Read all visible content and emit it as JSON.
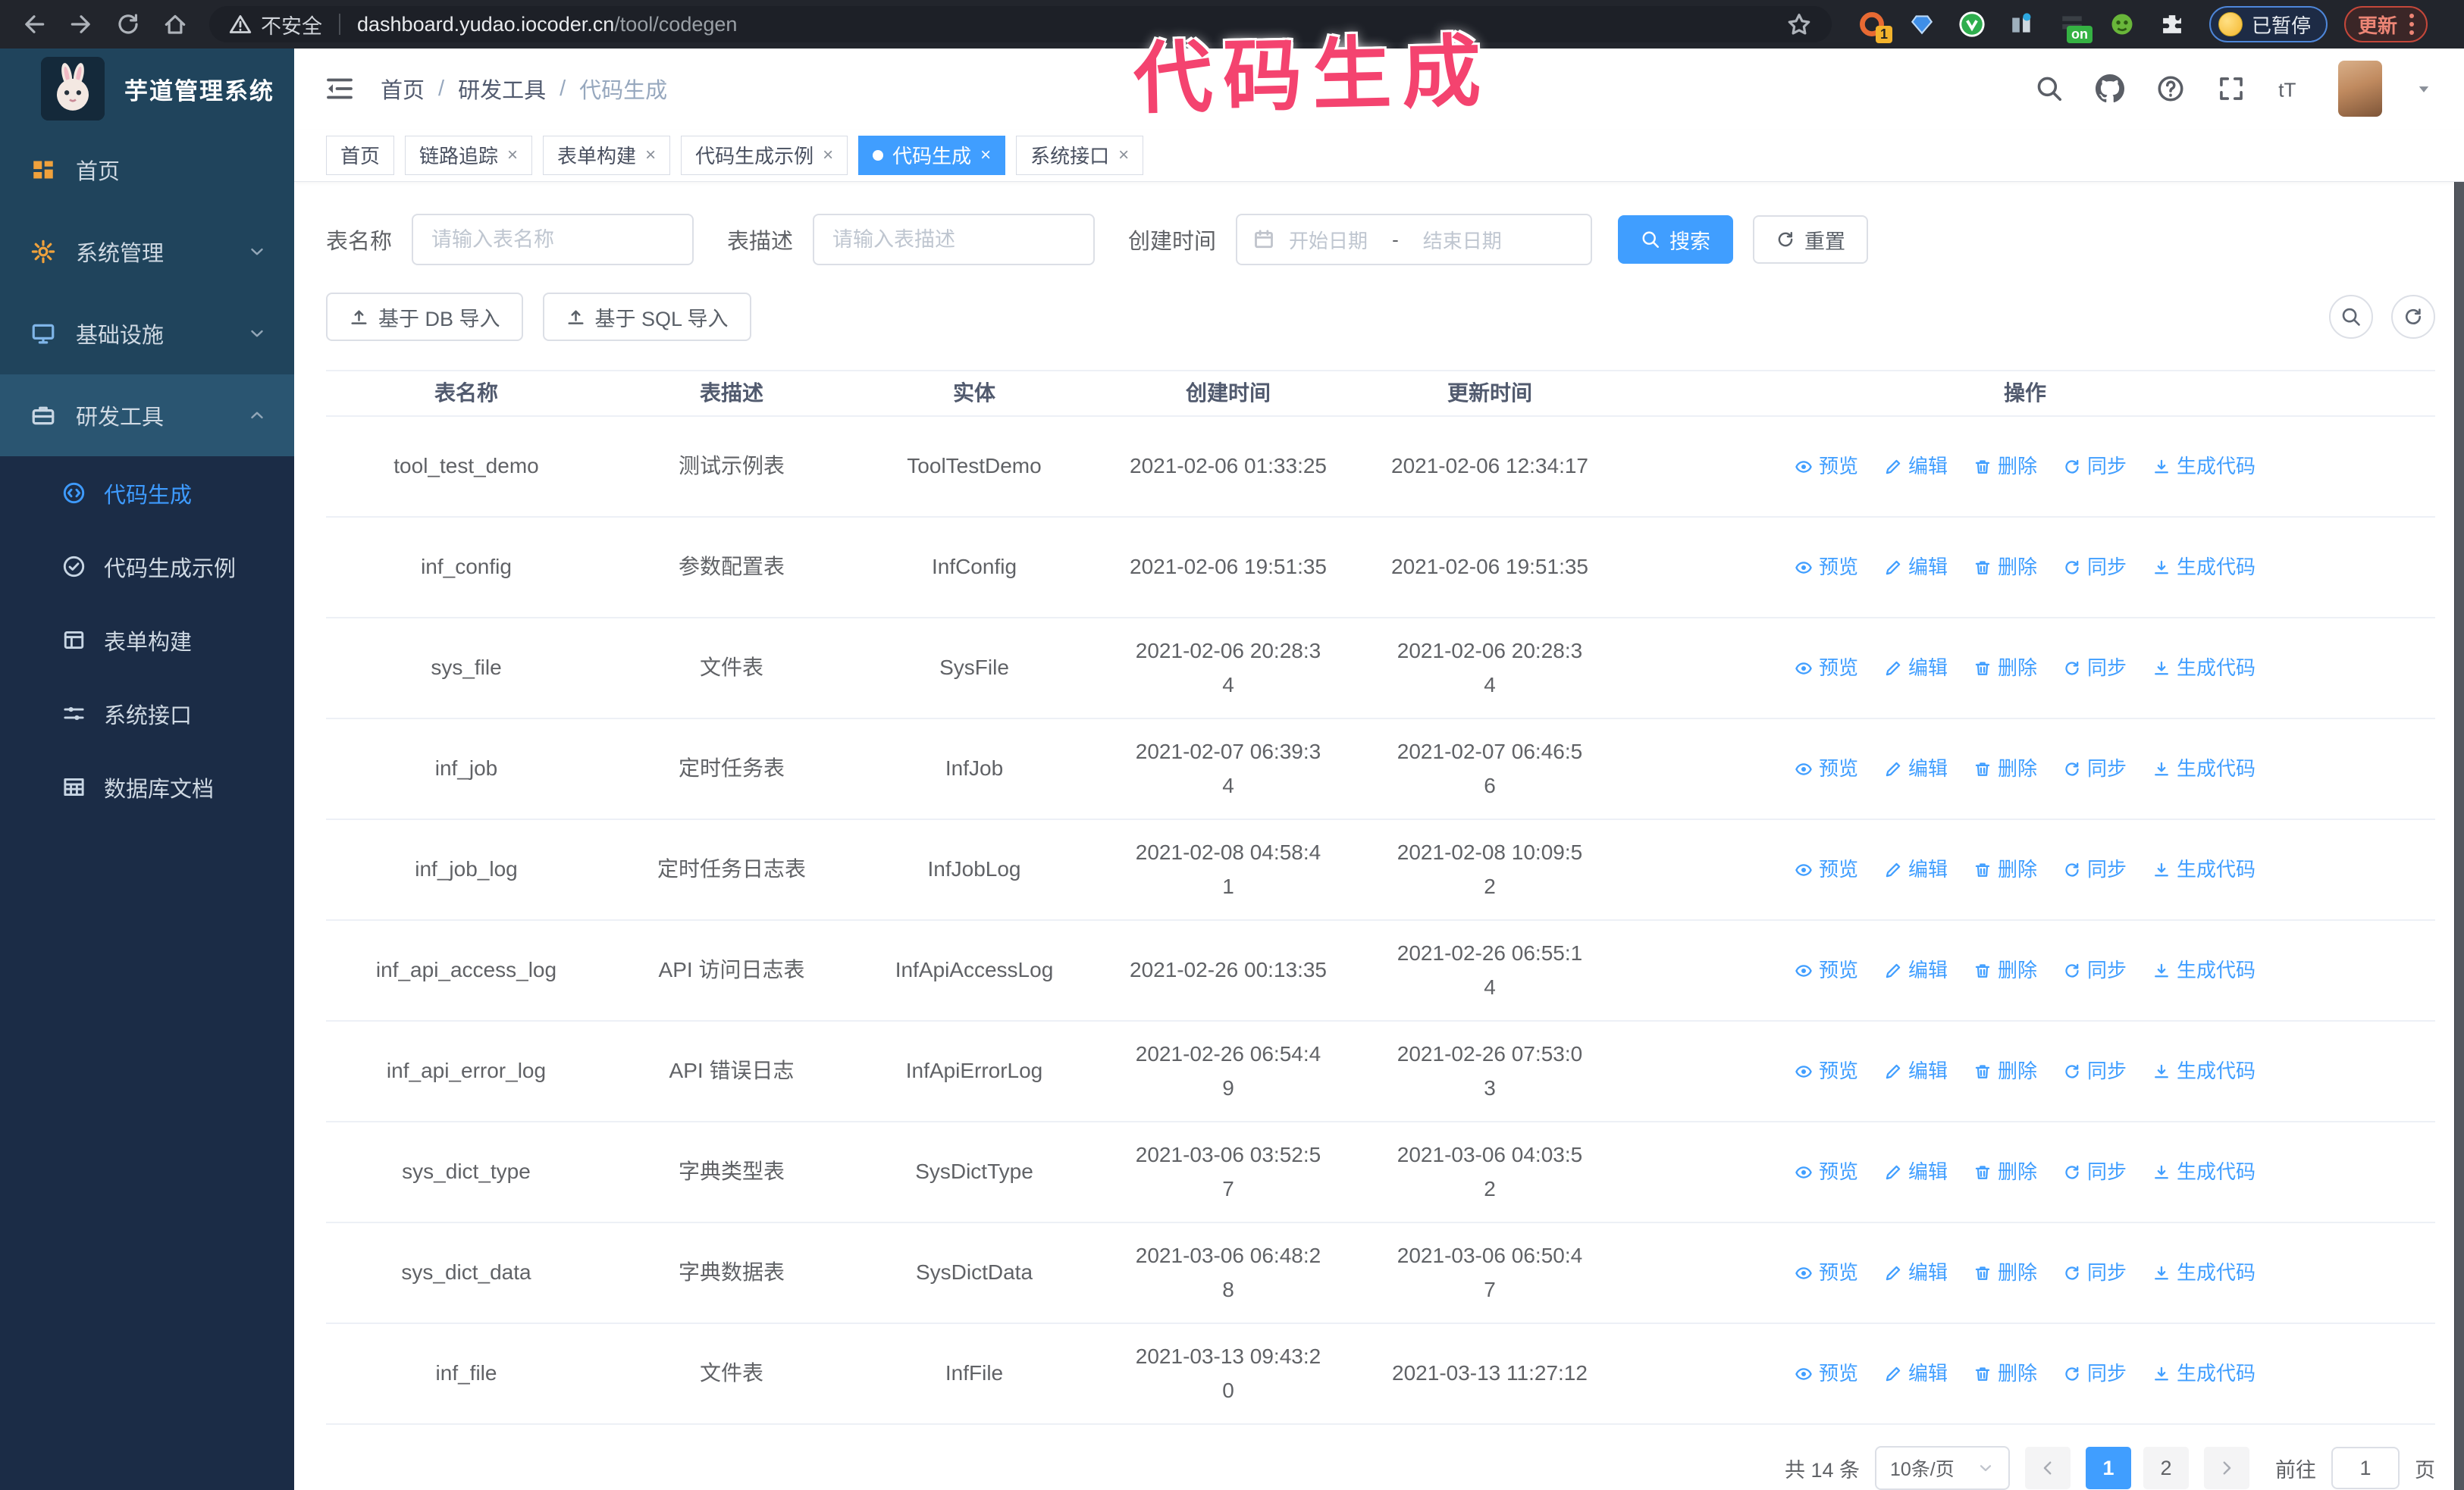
{
  "colors": {
    "accent": "#409eff",
    "annotation_pink": "#f4436f",
    "sidebar_bg": "#20445c",
    "submenu_bg": "#1b2c46",
    "chrome_bg": "#22252c"
  },
  "annotation": {
    "text": "代码生成"
  },
  "browser": {
    "warning_label": "不安全",
    "url_host": "dashboard.yudao.iocoder.cn",
    "url_path": "/tool/codegen",
    "extension_badge": "1",
    "on_badge": "on",
    "paused_chip": "已暂停",
    "update_button": "更新"
  },
  "sidebar": {
    "app_title": "芋道管理系统",
    "items": [
      {
        "label": "首页",
        "icon": "dashboard",
        "icon_color": "#f0a23c",
        "chevron": "",
        "active": false
      },
      {
        "label": "系统管理",
        "icon": "gear",
        "icon_color": "#f0a23c",
        "chevron": "down",
        "active": false
      },
      {
        "label": "基础设施",
        "icon": "infra",
        "icon_color": "#7fb5e8",
        "chevron": "down",
        "active": false
      },
      {
        "label": "研发工具",
        "icon": "tools",
        "icon_color": "#c8d6e4",
        "chevron": "up",
        "active": true
      }
    ],
    "submenu": [
      {
        "label": "代码生成",
        "icon": "code",
        "active": true
      },
      {
        "label": "代码生成示例",
        "icon": "example",
        "active": false
      },
      {
        "label": "表单构建",
        "icon": "form",
        "active": false
      },
      {
        "label": "系统接口",
        "icon": "api",
        "active": false
      },
      {
        "label": "数据库文档",
        "icon": "dbdoc",
        "active": false
      }
    ]
  },
  "header": {
    "breadcrumb": [
      "首页",
      "研发工具",
      "代码生成"
    ]
  },
  "tabs": [
    {
      "label": "首页",
      "closable": false,
      "active": false
    },
    {
      "label": "链路追踪",
      "closable": true,
      "active": false
    },
    {
      "label": "表单构建",
      "closable": true,
      "active": false
    },
    {
      "label": "代码生成示例",
      "closable": true,
      "active": false
    },
    {
      "label": "代码生成",
      "closable": true,
      "active": true
    },
    {
      "label": "系统接口",
      "closable": true,
      "active": false
    }
  ],
  "filters": {
    "name_label": "表名称",
    "name_placeholder": "请输入表名称",
    "desc_label": "表描述",
    "desc_placeholder": "请输入表描述",
    "time_label": "创建时间",
    "start_placeholder": "开始日期",
    "range_separator": "-",
    "end_placeholder": "结束日期",
    "search_label": "搜索",
    "reset_label": "重置"
  },
  "toolbar": {
    "db_import_label": "基于 DB 导入",
    "sql_import_label": "基于 SQL 导入"
  },
  "table": {
    "columns": [
      "表名称",
      "表描述",
      "实体",
      "创建时间",
      "更新时间",
      "操作"
    ],
    "actions": [
      {
        "label": "预览",
        "icon": "eye"
      },
      {
        "label": "编辑",
        "icon": "edit"
      },
      {
        "label": "删除",
        "icon": "delete"
      },
      {
        "label": "同步",
        "icon": "sync"
      },
      {
        "label": "生成代码",
        "icon": "download"
      }
    ],
    "rows": [
      {
        "name": "tool_test_demo",
        "desc": "测试示例表",
        "entity": "ToolTestDemo",
        "created": [
          "2021-02-06 01:33:25"
        ],
        "updated": [
          "2021-02-06 12:34:17"
        ]
      },
      {
        "name": "inf_config",
        "desc": "参数配置表",
        "entity": "InfConfig",
        "created": [
          "2021-02-06 19:51:35"
        ],
        "updated": [
          "2021-02-06 19:51:35"
        ]
      },
      {
        "name": "sys_file",
        "desc": "文件表",
        "entity": "SysFile",
        "created": [
          "2021-02-06 20:28:3",
          "4"
        ],
        "updated": [
          "2021-02-06 20:28:3",
          "4"
        ]
      },
      {
        "name": "inf_job",
        "desc": "定时任务表",
        "entity": "InfJob",
        "created": [
          "2021-02-07 06:39:3",
          "4"
        ],
        "updated": [
          "2021-02-07 06:46:5",
          "6"
        ]
      },
      {
        "name": "inf_job_log",
        "desc": "定时任务日志表",
        "entity": "InfJobLog",
        "created": [
          "2021-02-08 04:58:4",
          "1"
        ],
        "updated": [
          "2021-02-08 10:09:5",
          "2"
        ]
      },
      {
        "name": "inf_api_access_log",
        "desc": "API 访问日志表",
        "entity": "InfApiAccessLog",
        "created": [
          "2021-02-26 00:13:35"
        ],
        "updated": [
          "2021-02-26 06:55:1",
          "4"
        ]
      },
      {
        "name": "inf_api_error_log",
        "desc": "API 错误日志",
        "entity": "InfApiErrorLog",
        "created": [
          "2021-02-26 06:54:4",
          "9"
        ],
        "updated": [
          "2021-02-26 07:53:0",
          "3"
        ]
      },
      {
        "name": "sys_dict_type",
        "desc": "字典类型表",
        "entity": "SysDictType",
        "created": [
          "2021-03-06 03:52:5",
          "7"
        ],
        "updated": [
          "2021-03-06 04:03:5",
          "2"
        ]
      },
      {
        "name": "sys_dict_data",
        "desc": "字典数据表",
        "entity": "SysDictData",
        "created": [
          "2021-03-06 06:48:2",
          "8"
        ],
        "updated": [
          "2021-03-06 06:50:4",
          "7"
        ]
      },
      {
        "name": "inf_file",
        "desc": "文件表",
        "entity": "InfFile",
        "created": [
          "2021-03-13 09:43:2",
          "0"
        ],
        "updated": [
          "2021-03-13 11:27:12"
        ]
      }
    ]
  },
  "pagination": {
    "total_text": "共 14 条",
    "page_size": "10条/页",
    "pages": [
      "1",
      "2"
    ],
    "active_page": "1",
    "goto_label": "前往",
    "goto_value": "1",
    "goto_suffix": "页"
  }
}
